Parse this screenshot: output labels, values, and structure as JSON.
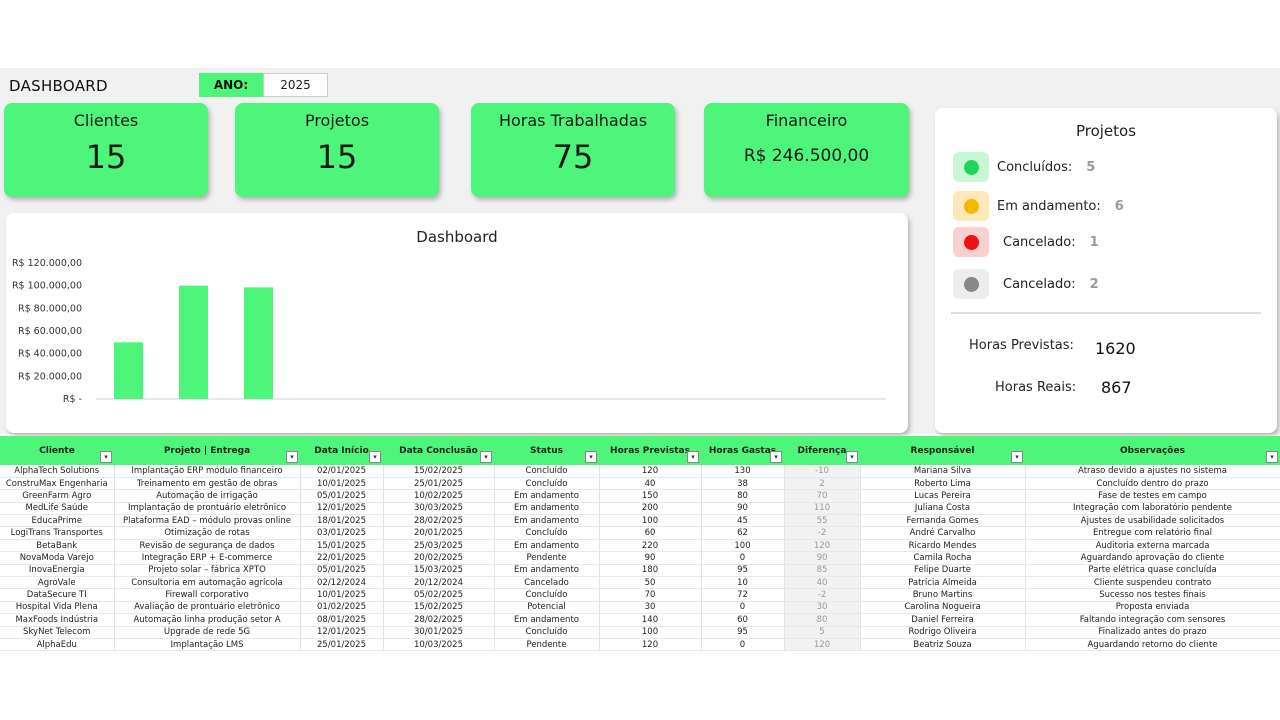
{
  "header": {
    "title": "DASHBOARD",
    "year_label": "ANO:",
    "year_value": "2025"
  },
  "kpis": {
    "clientes": {
      "label": "Clientes",
      "value": "15"
    },
    "projetos": {
      "label": "Projetos",
      "value": "15"
    },
    "horas": {
      "label": "Horas Trabalhadas",
      "value": "75"
    },
    "financeiro": {
      "label": "Financeiro",
      "value": "R$ 246.500,00"
    }
  },
  "chart_data": {
    "type": "bar",
    "title": "Dashboard",
    "categories": [
      "",
      "",
      ""
    ],
    "values": [
      50000,
      100000,
      98500
    ],
    "ylim": [
      0,
      120000
    ],
    "yticks": [
      "R$ -",
      "R$ 20.000,00",
      "R$ 40.000,00",
      "R$ 60.000,00",
      "R$ 80.000,00",
      "R$ 100.000,00",
      "R$ 120.000,00"
    ],
    "color": "#4df57a"
  },
  "side": {
    "title": "Projetos",
    "stats": [
      {
        "label": "Concluídos:",
        "value": "5",
        "chip": "#c9f7d3",
        "dot": "#1fd65a"
      },
      {
        "label": "Em andamento:",
        "value": "6",
        "chip": "#fde9b8",
        "dot": "#f5b800"
      },
      {
        "label": "Cancelado:",
        "value": "1",
        "chip": "#f8d0d0",
        "dot": "#ee1111"
      },
      {
        "label": "Cancelado:",
        "value": "2",
        "chip": "#ededed",
        "dot": "#888888"
      }
    ],
    "horas_previstas_label": "Horas Previstas:",
    "horas_previstas_value": "1620",
    "horas_reais_label": "Horas Reais:",
    "horas_reais_value": "867"
  },
  "table": {
    "columns": [
      "Cliente",
      "Projeto | Entrega",
      "Data Início",
      "Data Conclusão",
      "Status",
      "Horas Previstas",
      "Horas Gastas",
      "Diferença",
      "Responsável",
      "Observações"
    ],
    "rows": [
      [
        "AlphaTech Solutions",
        "Implantação ERP módulo financeiro",
        "02/01/2025",
        "15/02/2025",
        "Concluído",
        "120",
        "130",
        "-10",
        "Mariana Silva",
        "Atraso devido a ajustes no sistema"
      ],
      [
        "ConstruMax Engenharia",
        "Treinamento em gestão de obras",
        "10/01/2025",
        "25/01/2025",
        "Concluído",
        "40",
        "38",
        "2",
        "Roberto Lima",
        "Concluído dentro do prazo"
      ],
      [
        "GreenFarm Agro",
        "Automação de irrigação",
        "05/01/2025",
        "10/02/2025",
        "Em andamento",
        "150",
        "80",
        "70",
        "Lucas Pereira",
        "Fase de testes em campo"
      ],
      [
        "MedLife Saúde",
        "Implantação de prontuário eletrônico",
        "12/01/2025",
        "30/03/2025",
        "Em andamento",
        "200",
        "90",
        "110",
        "Juliana Costa",
        "Integração com laboratório pendente"
      ],
      [
        "EducaPrime",
        "Plataforma EAD – módulo provas online",
        "18/01/2025",
        "28/02/2025",
        "Em andamento",
        "100",
        "45",
        "55",
        "Fernanda Gomes",
        "Ajustes de usabilidade solicitados"
      ],
      [
        "LogiTrans Transportes",
        "Otimização de rotas",
        "03/01/2025",
        "20/01/2025",
        "Concluído",
        "60",
        "62",
        "-2",
        "André Carvalho",
        "Entregue com relatório final"
      ],
      [
        "BetaBank",
        "Revisão de segurança de dados",
        "15/01/2025",
        "25/03/2025",
        "Em andamento",
        "220",
        "100",
        "120",
        "Ricardo Mendes",
        "Auditoria externa marcada"
      ],
      [
        "NovaModa Varejo",
        "Integração ERP + E-commerce",
        "22/01/2025",
        "20/02/2025",
        "Pendente",
        "90",
        "0",
        "90",
        "Camila Rocha",
        "Aguardando aprovação do cliente"
      ],
      [
        "InovaEnergia",
        "Projeto solar – fábrica XPTO",
        "05/01/2025",
        "15/03/2025",
        "Em andamento",
        "180",
        "95",
        "85",
        "Felipe Duarte",
        "Parte elétrica quase concluída"
      ],
      [
        "AgroVale",
        "Consultoria em automação agrícola",
        "02/12/2024",
        "20/12/2024",
        "Cancelado",
        "50",
        "10",
        "40",
        "Patrícia Almeida",
        "Cliente suspendeu contrato"
      ],
      [
        "DataSecure TI",
        "Firewall corporativo",
        "10/01/2025",
        "05/02/2025",
        "Concluído",
        "70",
        "72",
        "-2",
        "Bruno Martins",
        "Sucesso nos testes finais"
      ],
      [
        "Hospital Vida Plena",
        "Avaliação de prontuário eletrônico",
        "01/02/2025",
        "15/02/2025",
        "Potencial",
        "30",
        "0",
        "30",
        "Carolina Nogueira",
        "Proposta enviada"
      ],
      [
        "MaxFoods Indústria",
        "Automação linha produção setor A",
        "08/01/2025",
        "28/02/2025",
        "Em andamento",
        "140",
        "60",
        "80",
        "Daniel Ferreira",
        "Faltando integração com sensores"
      ],
      [
        "SkyNet Telecom",
        "Upgrade de rede 5G",
        "12/01/2025",
        "30/01/2025",
        "Concluído",
        "100",
        "95",
        "5",
        "Rodrigo Oliveira",
        "Finalizado antes do prazo"
      ],
      [
        "AlphaEdu",
        "Implantação LMS",
        "25/01/2025",
        "10/03/2025",
        "Pendente",
        "120",
        "0",
        "120",
        "Beatriz Souza",
        "Aguardando retorno do cliente"
      ]
    ]
  }
}
